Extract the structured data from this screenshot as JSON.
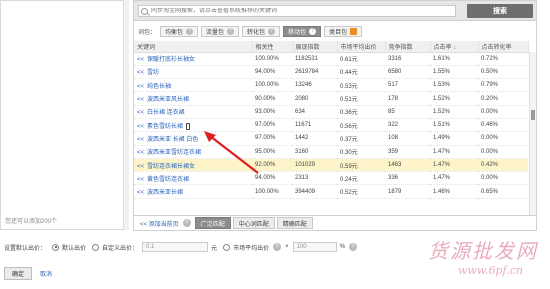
{
  "left_panel": {
    "footnote": "您还可以添加200个"
  },
  "search": {
    "placeholder": "同步淘宝网搜索，请点击查看系统推荐的关键词",
    "button_label": "搜索"
  },
  "filters": {
    "label": "词包：",
    "chips": [
      {
        "label": "均衡包",
        "active": false
      },
      {
        "label": "流量包",
        "active": false
      },
      {
        "label": "转化包",
        "active": false
      },
      {
        "label": "移动包",
        "active": true
      },
      {
        "label": "类目包",
        "active": false
      }
    ]
  },
  "table": {
    "columns": [
      "关键词",
      "相关性",
      "展现指数",
      "市场平均出价",
      "竞争指数",
      "点击率",
      "点击转化率"
    ],
    "sorted_column": "点击率",
    "rows": [
      {
        "keyword": "保暖打底衫长袖女",
        "relevance": "100.00%",
        "impressions": "1182531",
        "avg_bid": "0.61元",
        "competition": "3316",
        "ctr": "1.61%",
        "cvr": "0.72%",
        "highlight": false
      },
      {
        "keyword": "雪纺",
        "relevance": "94.00%",
        "impressions": "2619784",
        "avg_bid": "0.44元",
        "competition": "6580",
        "ctr": "1.55%",
        "cvr": "0.50%",
        "highlight": false
      },
      {
        "keyword": "纯色长袖",
        "relevance": "100.00%",
        "impressions": "13246",
        "avg_bid": "0.53元",
        "competition": "517",
        "ctr": "1.53%",
        "cvr": "0.79%",
        "highlight": false
      },
      {
        "keyword": "波西米亚风长裙",
        "relevance": "90.00%",
        "impressions": "2080",
        "avg_bid": "0.51元",
        "competition": "178",
        "ctr": "1.52%",
        "cvr": "0.20%",
        "highlight": false
      },
      {
        "keyword": "白长裙 连衣裙",
        "relevance": "93.00%",
        "impressions": "634",
        "avg_bid": "0.36元",
        "competition": "85",
        "ctr": "1.52%",
        "cvr": "0.00%",
        "highlight": false
      },
      {
        "keyword": "素色雪纺长裙",
        "relevance": "97.00%",
        "impressions": "11671",
        "avg_bid": "0.56元",
        "competition": "322",
        "ctr": "1.51%",
        "cvr": "0.46%",
        "highlight": false,
        "mobile": true
      },
      {
        "keyword": "波西米亚 长裙 白色",
        "relevance": "97.00%",
        "impressions": "1442",
        "avg_bid": "0.37元",
        "competition": "108",
        "ctr": "1.49%",
        "cvr": "0.00%",
        "highlight": false
      },
      {
        "keyword": "波西米亚雪纺连衣裙",
        "relevance": "95.00%",
        "impressions": "3160",
        "avg_bid": "0.30元",
        "competition": "359",
        "ctr": "1.47%",
        "cvr": "0.00%",
        "highlight": false
      },
      {
        "keyword": "雪纺连衣裙长裙女",
        "relevance": "92.00%",
        "impressions": "101029",
        "avg_bid": "0.59元",
        "competition": "1463",
        "ctr": "1.47%",
        "cvr": "0.42%",
        "highlight": true
      },
      {
        "keyword": "黄色雪纺连衣裙",
        "relevance": "94.00%",
        "impressions": "2313",
        "avg_bid": "0.24元",
        "competition": "336",
        "ctr": "1.47%",
        "cvr": "0.00%",
        "highlight": false
      },
      {
        "keyword": "波西米亚长裙",
        "relevance": "100.00%",
        "impressions": "394409",
        "avg_bid": "0.52元",
        "competition": "1879",
        "ctr": "1.46%",
        "cvr": "0.65%",
        "highlight": false
      }
    ]
  },
  "bottom_bar": {
    "add_link": "<< 添加当前页",
    "tabs": [
      {
        "label": "广泛匹配",
        "active": true
      },
      {
        "label": "中心词匹配",
        "active": false
      },
      {
        "label": "精确匹配",
        "active": false
      }
    ]
  },
  "bid_settings": {
    "label": "设置默认出价：",
    "default_bid": "默认出价",
    "custom_bid": "自定义出价：",
    "custom_value": "0.1",
    "unit_yuan": "元",
    "market_avg": "市场平均出价",
    "multiply": "×",
    "percent_value": "100",
    "unit_percent": "%"
  },
  "actions": {
    "confirm": "确定",
    "cancel": "取消"
  },
  "watermark": {
    "title": "货源批发网",
    "url": "www.6pf.cn"
  }
}
